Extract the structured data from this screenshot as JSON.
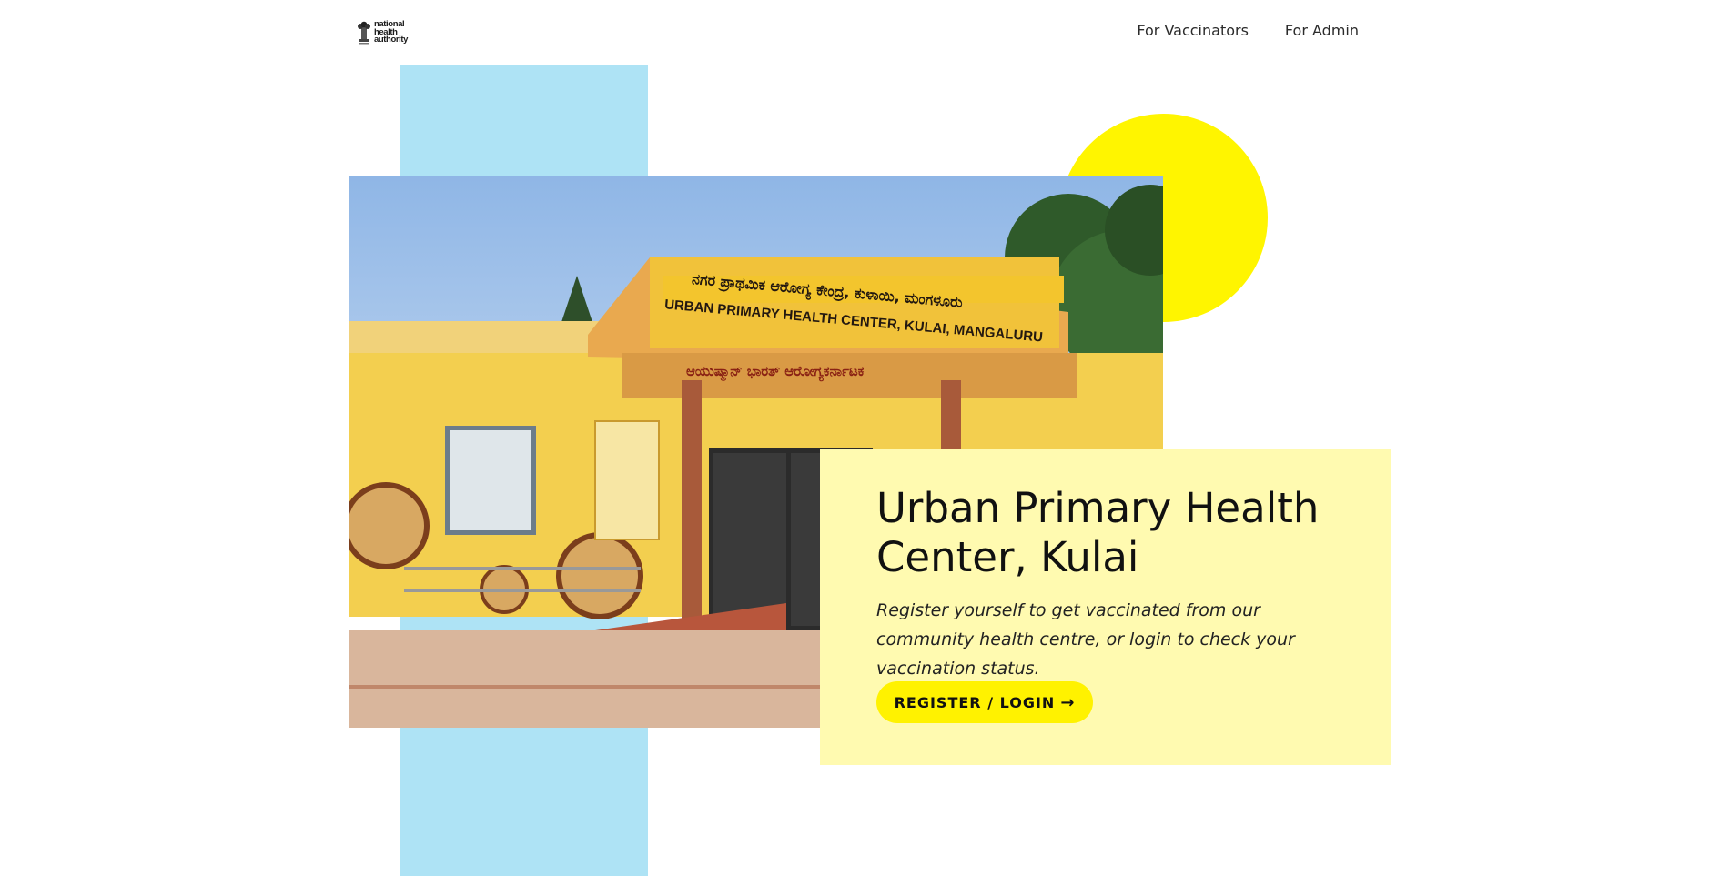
{
  "header": {
    "logo": {
      "lines": [
        "national",
        "health",
        "authority"
      ]
    },
    "nav": [
      {
        "label": "For Vaccinators"
      },
      {
        "label": "For Admin"
      }
    ]
  },
  "hero": {
    "photo": {
      "sign_kannada": "ನಗರ ಪ್ರಾಥಮಿಕ ಆರೋಗ್ಯ ಕೇಂದ್ರ, ಕುಳಾಯಿ, ಮಂಗಳೂರು",
      "sign_english": "URBAN PRIMARY HEALTH CENTER, KULAI, MANGALURU",
      "sign_secondary": "ಆಯುಷ್ಮಾನ್ ಭಾರತ್ ಆರೋಗ್ಯಕರ್ನಾಟಕ"
    },
    "title": "Urban Primary Health Center, Kulai",
    "description": "Register yourself to get vaccinated from our community health centre, or login to check your vaccination status.",
    "cta": {
      "label": "REGISTER / LOGIN",
      "icon": "arrow-right-icon"
    }
  },
  "colors": {
    "blue_bar": "#aee3f5",
    "yellow_circle": "#fff500",
    "card_bg": "#fffab0",
    "cta_bg": "#fff200"
  }
}
